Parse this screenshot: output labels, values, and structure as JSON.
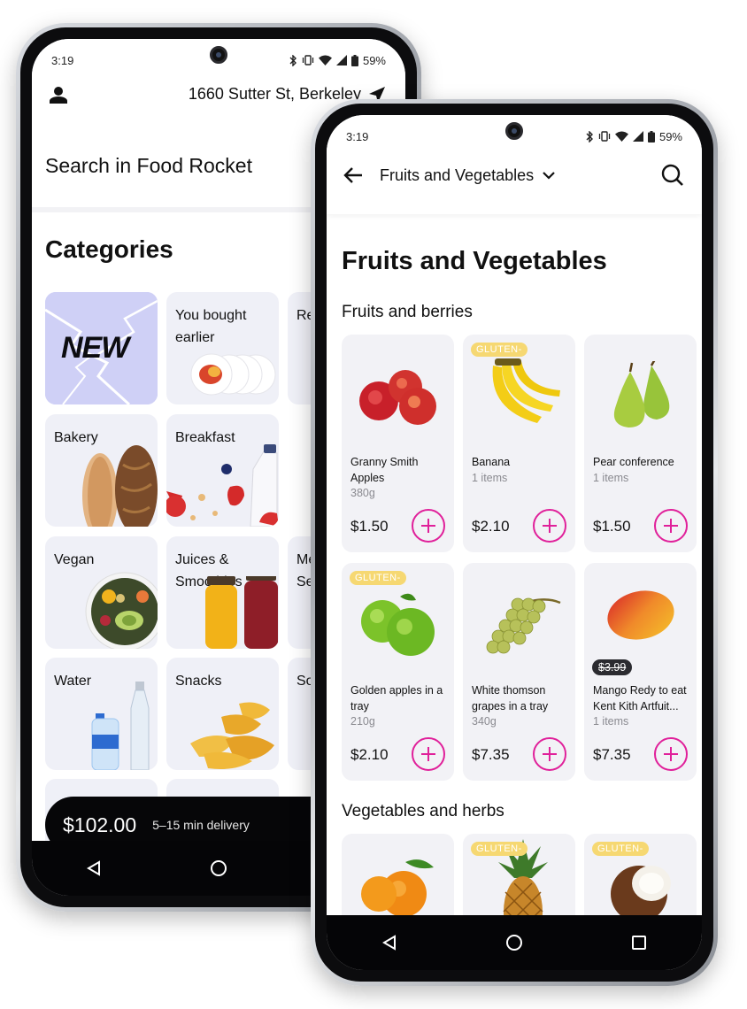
{
  "phone_left": {
    "status": {
      "time": "3:19",
      "battery": "59%"
    },
    "address": "1660 Sutter St, Berkeley",
    "search_label": "Search in Food Rocket",
    "categories_title": "Categories",
    "categories": [
      {
        "label": "NEW",
        "image": "new-lightning-icon"
      },
      {
        "label": "You bought earlier",
        "image": "apple-plates-icon"
      },
      {
        "label": "Rea",
        "image": "partial-tile"
      },
      {
        "label": "Bakery",
        "image": "bread-icon"
      },
      {
        "label": "Breakfast",
        "image": "milk-berries-icon"
      },
      {
        "label": "Vegan",
        "image": "salad-bowl-icon"
      },
      {
        "label": "Juices & Smoothies",
        "image": "juice-bottles-icon"
      },
      {
        "label": "Me Sea",
        "image": "partial-tile"
      },
      {
        "label": "Water",
        "image": "water-bottles-icon"
      },
      {
        "label": "Snacks",
        "image": "chips-icon"
      },
      {
        "label": "So",
        "image": "partial-tile"
      }
    ],
    "cart": {
      "total": "$102.00",
      "delivery": "5–15 min delivery"
    }
  },
  "phone_right": {
    "status": {
      "time": "3:19",
      "battery": "59%"
    },
    "toolbar_title": "Fruits and Vegetables",
    "page_title": "Fruits and Vegetables",
    "sections": [
      {
        "title": "Fruits and berries"
      },
      {
        "title": "Vegetables and herbs"
      }
    ],
    "products": [
      {
        "name": "Granny Smith Apples",
        "qty": "380g",
        "price": "$1.50",
        "badge": "",
        "old_price": "",
        "image": "red-apples-icon"
      },
      {
        "name": "Banana",
        "qty": "1 items",
        "price": "$2.10",
        "badge": "GLUTEN-",
        "old_price": "",
        "image": "banana-icon"
      },
      {
        "name": "Pear conference",
        "qty": "1 items",
        "price": "$1.50",
        "badge": "",
        "old_price": "",
        "image": "pear-icon"
      },
      {
        "name": "Golden apples in a tray",
        "qty": "210g",
        "price": "$2.10",
        "badge": "GLUTEN-",
        "old_price": "",
        "image": "green-apples-icon"
      },
      {
        "name": "White thomson grapes in a tray",
        "qty": "340g",
        "price": "$7.35",
        "badge": "",
        "old_price": "",
        "image": "grapes-icon"
      },
      {
        "name": "Mango Redy to eat Kent Kith Artfuit...",
        "qty": "1 items",
        "price": "$7.35",
        "badge": "",
        "old_price": "$3.99",
        "image": "mango-icon"
      }
    ],
    "veg_items": [
      {
        "badge": "",
        "image": "tangerine-icon"
      },
      {
        "badge": "GLUTEN-",
        "image": "pineapple-icon"
      },
      {
        "badge": "GLUTEN-",
        "image": "coconut-icon"
      }
    ]
  },
  "colors": {
    "accent": "#e0209a",
    "badge": "#f6d872",
    "card": "#f2f2f6",
    "dark": "#060608"
  }
}
